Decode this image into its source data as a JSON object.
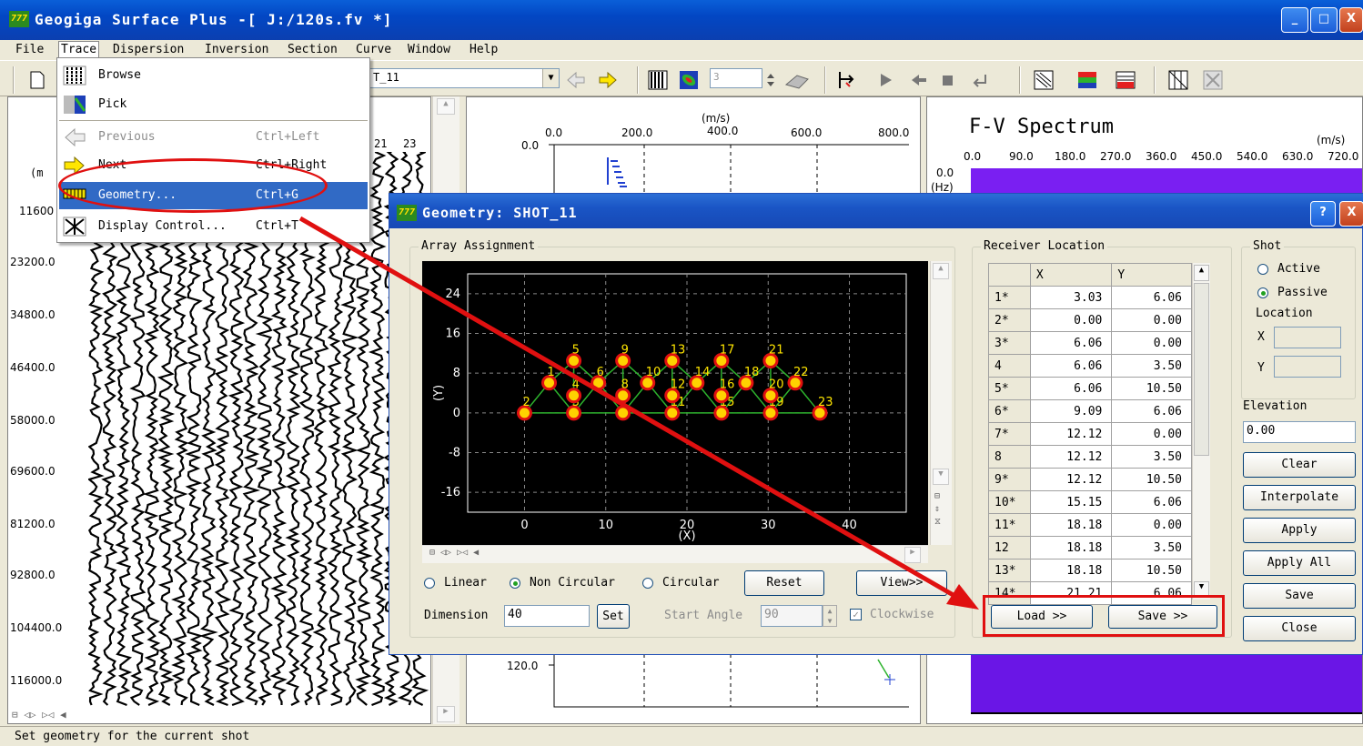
{
  "window": {
    "title": "Geogiga Surface Plus -[ J:/120s.fv *]",
    "icon_text": "777",
    "minimize": "_",
    "maximize": "□",
    "close": "X"
  },
  "menubar": [
    "File",
    "Trace",
    "Dispersion",
    "Inversion",
    "Section",
    "Curve",
    "Window",
    "Help"
  ],
  "toolbar": {
    "shot_combo": "T_11",
    "spin_value": "3"
  },
  "trace_menu": [
    {
      "label": "Browse",
      "accel": ""
    },
    {
      "label": "Pick",
      "accel": ""
    },
    {
      "label": "Previous",
      "accel": "Ctrl+Left"
    },
    {
      "label": "Next",
      "accel": "Ctrl+Right"
    },
    {
      "label": "Geometry...",
      "accel": "Ctrl+G"
    },
    {
      "label": "Display Control...",
      "accel": "Ctrl+T"
    }
  ],
  "left_pane": {
    "ticks": [
      "21",
      "23"
    ],
    "unit": "(m",
    "y_labels": [
      "11600",
      "23200.0",
      "34800.0",
      "46400.0",
      "58000.0",
      "69600.0",
      "81200.0",
      "92800.0",
      "104400.0",
      "116000.0"
    ]
  },
  "middle_pane": {
    "unit": "(m/s)",
    "x_labels": [
      "0.0",
      "200.0",
      "400.0",
      "600.0",
      "800.0"
    ],
    "y_top": "0.0",
    "y_bottom": "120.0"
  },
  "right_pane": {
    "title": "F-V Spectrum",
    "unit": "(m/s)",
    "x_labels": [
      "0.0",
      "90.0",
      "180.0",
      "270.0",
      "360.0",
      "450.0",
      "540.0",
      "630.0",
      "720.0"
    ],
    "y_top": "0.0",
    "y_unit": "(Hz)"
  },
  "dialog": {
    "title": "Geometry: SHOT_11",
    "help": "?",
    "close": "X",
    "array_group": "Array Assignment",
    "plot": {
      "y_axis": "(Y)",
      "x_axis": "(X)",
      "y_ticks": [
        "24",
        "16",
        "8",
        "0",
        "-8",
        "-16"
      ],
      "x_ticks": [
        "0",
        "10",
        "20",
        "30",
        "40"
      ]
    },
    "mode": {
      "linear": "Linear",
      "non_circular": "Non Circular",
      "circular": "Circular",
      "selected": "Non Circular"
    },
    "reset": "Reset",
    "view": "View>>",
    "dimension_label": "Dimension",
    "dimension_value": "40",
    "set": "Set",
    "start_angle_label": "Start Angle",
    "start_angle_value": "90",
    "clockwise": "Clockwise",
    "receiver_group": "Receiver Location",
    "receiver_headers": [
      "",
      "X",
      "Y"
    ],
    "receivers": [
      [
        "1*",
        "3.03",
        "6.06"
      ],
      [
        "2*",
        "0.00",
        "0.00"
      ],
      [
        "3*",
        "6.06",
        "0.00"
      ],
      [
        "4",
        "6.06",
        "3.50"
      ],
      [
        "5*",
        "6.06",
        "10.50"
      ],
      [
        "6*",
        "9.09",
        "6.06"
      ],
      [
        "7*",
        "12.12",
        "0.00"
      ],
      [
        "8",
        "12.12",
        "3.50"
      ],
      [
        "9*",
        "12.12",
        "10.50"
      ],
      [
        "10*",
        "15.15",
        "6.06"
      ],
      [
        "11*",
        "18.18",
        "0.00"
      ],
      [
        "12",
        "18.18",
        "3.50"
      ],
      [
        "13*",
        "18.18",
        "10.50"
      ],
      [
        "14*",
        "21.21",
        "6.06"
      ]
    ],
    "load": "Load >>",
    "save": "Save >>",
    "shot_group": "Shot",
    "active": "Active",
    "passive": "Passive",
    "location": "Location",
    "x": "X",
    "y": "Y",
    "elevation": "Elevation",
    "elevation_value": "0.00",
    "clear": "Clear",
    "interpolate": "Interpolate",
    "apply": "Apply",
    "apply_all": "Apply All",
    "save_btn": "Save",
    "close_btn": "Close"
  },
  "status": "Set geometry for the current shot"
}
